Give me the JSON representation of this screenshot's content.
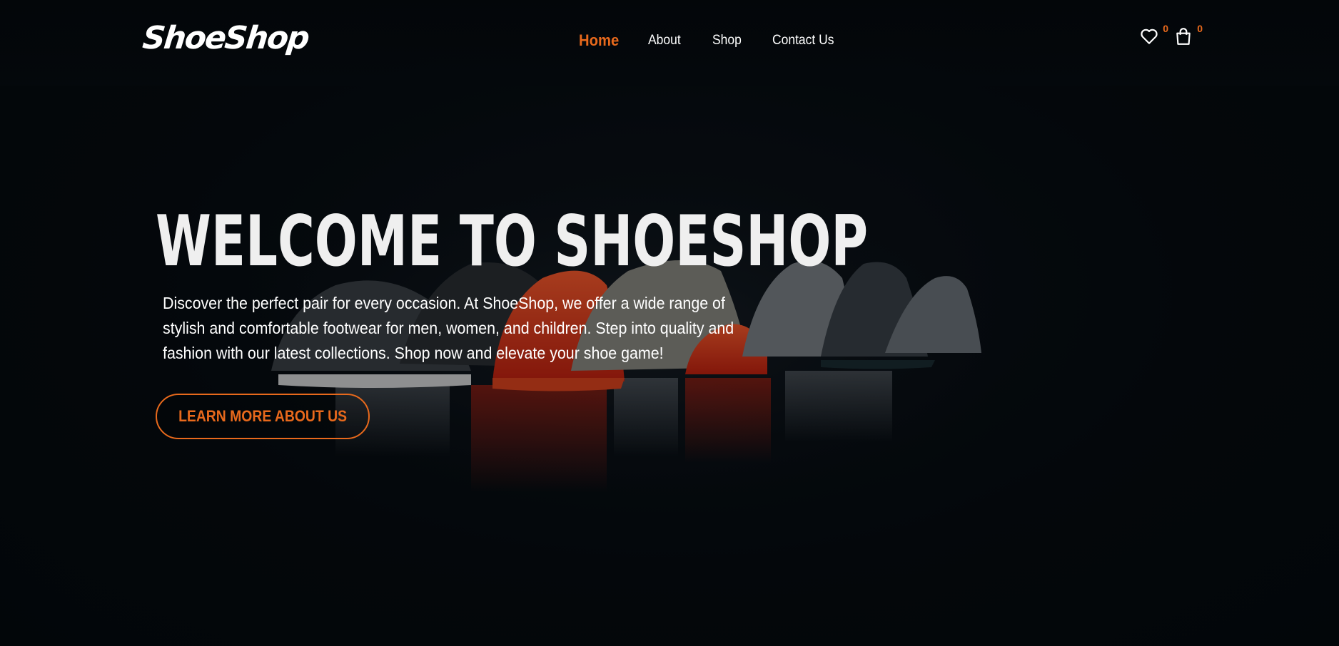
{
  "header": {
    "logo_text": "ShoeShop",
    "nav": {
      "home": "Home",
      "about": "About",
      "shop": "Shop",
      "contact": "Contact Us"
    },
    "wishlist_icon": "heart-icon",
    "wishlist_count": "0",
    "cart_icon": "shopping-bag-icon",
    "cart_count": "0"
  },
  "hero": {
    "title": "WELCOME TO SHOESHOP",
    "description": "Discover the perfect pair for every occasion. At ShoeShop, we offer a wide range of stylish and comfortable footwear for men, women, and children. Step into quality and fashion with our latest collections. Shop now and elevate your shoe game!",
    "cta_label": "LEARN MORE ABOUT US"
  },
  "colors": {
    "accent": "#e8691c",
    "background": "#03080c",
    "text": "#ffffff"
  }
}
